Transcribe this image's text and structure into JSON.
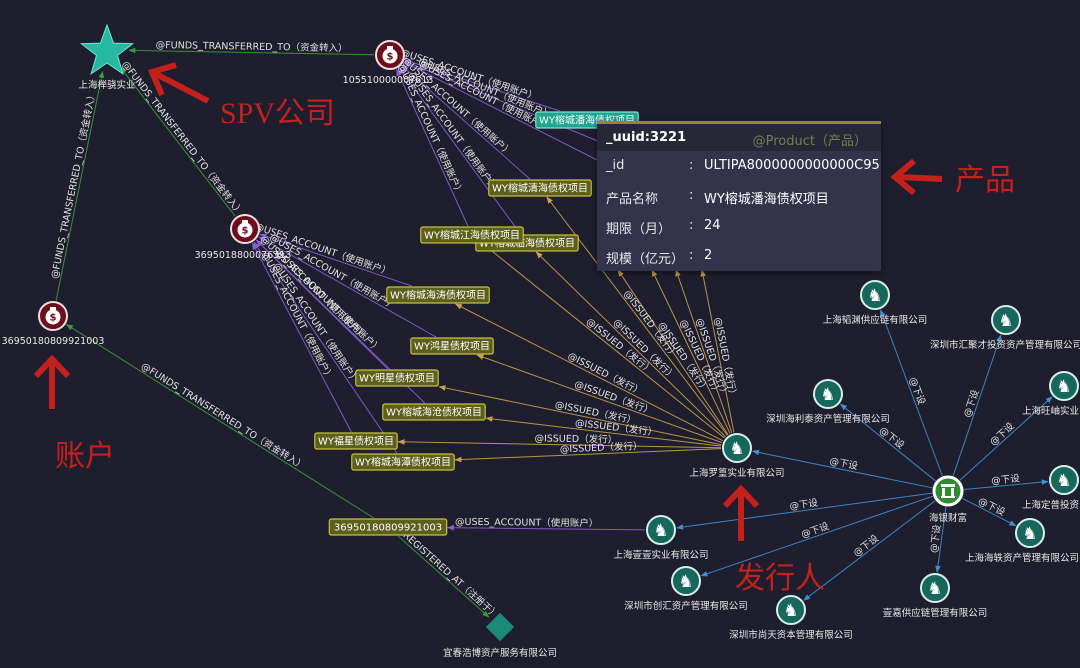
{
  "colors": {
    "background": "#1f1e2e",
    "funds": "#3c9c3c",
    "uses": "#8a5ed4",
    "issued": "#c9a24e",
    "sub": "#3a90d2",
    "registered": "#3c9c3c",
    "company": "#17675d",
    "account": "#6e0d1c",
    "hub": "#2e8b2e",
    "spv": "#26b8a0",
    "registry": "#1b8a78",
    "product_fill": "#5d5f1c",
    "product_border": "#c6c23c",
    "product_selected": "#1ea68f",
    "annotation": "#c4201c"
  },
  "nodes": [
    {
      "id": "spv",
      "icon": "star-icon",
      "label": "上海榉骁实业"
    },
    {
      "id": "acct_a",
      "icon": "money-bag-icon",
      "label": "105510000007613"
    },
    {
      "id": "acct_b",
      "icon": "money-bag-icon",
      "label": "3695018800076313"
    },
    {
      "id": "acct_c",
      "icon": "money-bag-icon",
      "label": "36950180809921003"
    },
    {
      "id": "box_acct",
      "icon": "account-box",
      "label": "36950180809921003"
    },
    {
      "id": "issuer",
      "icon": "knight-icon",
      "label": "上海罗篁实业有限公司"
    },
    {
      "id": "haiyin",
      "icon": "bank-icon",
      "label": "海银财富"
    },
    {
      "id": "c1",
      "icon": "knight-icon",
      "label": "深圳海利泰资产管理有限公司"
    },
    {
      "id": "c2",
      "icon": "knight-icon",
      "label": "上海韬渊供应链有限公司"
    },
    {
      "id": "c3",
      "icon": "knight-icon",
      "label": "深圳市汇聚才投资资产管理有限公司"
    },
    {
      "id": "c4",
      "icon": "knight-icon",
      "label": "上海旺岫实业"
    },
    {
      "id": "c5",
      "icon": "knight-icon",
      "label": "上海定普投资"
    },
    {
      "id": "c6",
      "icon": "knight-icon",
      "label": "上海海轶资产管理有限公司"
    },
    {
      "id": "c7",
      "icon": "knight-icon",
      "label": "壹嘉供应链管理有限公司"
    },
    {
      "id": "c8",
      "icon": "knight-icon",
      "label": "深圳市尚天资本管理有限公司"
    },
    {
      "id": "c9",
      "icon": "knight-icon",
      "label": "深圳市创汇资产管理有限公司"
    },
    {
      "id": "c10",
      "icon": "knight-icon",
      "label": "上海壹壹实业有限公司"
    },
    {
      "id": "reg",
      "icon": "diamond-icon",
      "label": "宜春浩博资产服务有限公司"
    }
  ],
  "products": [
    {
      "id": "p1",
      "label": "WY榕城潘海债权项目",
      "selected": true
    },
    {
      "id": "p2",
      "label": "WY榕城清海债权项目",
      "selected": false
    },
    {
      "id": "p4",
      "label": "WY榕城临海债权项目",
      "selected": false
    },
    {
      "id": "p3",
      "label": "WY榕城江海债权项目",
      "selected": false
    },
    {
      "id": "p5",
      "label": "WY榕城海涛债权项目",
      "selected": false
    },
    {
      "id": "p6",
      "label": "WY鸿星债权项目",
      "selected": false
    },
    {
      "id": "p7",
      "label": "WY明星债权项目",
      "selected": false
    },
    {
      "id": "p8",
      "label": "WY榕城海沧债权项目",
      "selected": false
    },
    {
      "id": "p9",
      "label": "WY福星债权项目",
      "selected": false
    },
    {
      "id": "p10",
      "label": "WY榕城海潭债权项目",
      "selected": false
    }
  ],
  "edges": [
    {
      "from": "acct_a",
      "to": "spv",
      "type": "funds",
      "label": "@FUNDS_TRANSFERRED_TO（资金转入）"
    },
    {
      "from": "acct_c",
      "to": "spv",
      "type": "funds",
      "label": "@FUNDS_TRANSFERRED_TO（资金转入）"
    },
    {
      "from": "acct_b",
      "to": "spv",
      "type": "funds",
      "label": "@FUNDS_TRANSFERRED_TO（资金转入）"
    },
    {
      "from": "box_acct",
      "to": "acct_c",
      "type": "funds",
      "label": "@FUNDS_TRANSFERRED_TO（资金转入）"
    },
    {
      "from": "c10",
      "to": "box_acct",
      "type": "uses",
      "label": "@USES_ACCOUNT（使用账户）"
    },
    {
      "from": "box_acct",
      "to": "reg",
      "type": "registered",
      "label": "@REGISTERED_AT（注册于）"
    },
    {
      "from": "p1",
      "to": "acct_a",
      "type": "uses",
      "label": "@USES_ACCOUNT（使用账户）"
    },
    {
      "from": "a1",
      "to": "acct_a",
      "type": "uses",
      "label": "@USES_ACCOUNT（使用账户）"
    },
    {
      "from": "a2",
      "to": "acct_a",
      "type": "uses",
      "label": "@USES_ACCOUNT（使用账户）"
    },
    {
      "from": "p2",
      "to": "acct_a",
      "type": "uses",
      "label": "@USES_ACCOUNT（使用账户）"
    },
    {
      "from": "p4",
      "to": "acct_a",
      "type": "uses",
      "label": "@USES_ACCOUNT（使用账户）"
    },
    {
      "from": "p3",
      "to": "acct_a",
      "type": "uses",
      "label": "@USES_ACCOUNT（使用账户）"
    },
    {
      "from": "p5",
      "to": "acct_b",
      "type": "uses",
      "label": "@USES_ACCOUNT（使用账户）"
    },
    {
      "from": "p6",
      "to": "acct_b",
      "type": "uses",
      "label": "@USES_ACCOUNT（使用账户）"
    },
    {
      "from": "p7",
      "to": "acct_b",
      "type": "uses",
      "label": "@USES_ACCOUNT（使用账户）"
    },
    {
      "from": "p8",
      "to": "acct_b",
      "type": "uses",
      "label": "@USES_ACCOUNT（使用账户）"
    },
    {
      "from": "p9",
      "to": "acct_b",
      "type": "uses",
      "label": "@USES_ACCOUNT（使用账户）"
    },
    {
      "from": "p10",
      "to": "acct_b",
      "type": "uses",
      "label": "@USES_ACCOUNT（使用账户）"
    },
    {
      "from": "issuer",
      "to": "p2",
      "type": "issued",
      "label": "@ISSUED（发行）"
    },
    {
      "from": "issuer",
      "to": "p3",
      "type": "issued",
      "label": "@ISSUED（发行）"
    },
    {
      "from": "issuer",
      "to": "p4",
      "type": "issued",
      "label": "@ISSUED（发行）"
    },
    {
      "from": "issuer",
      "to": "p5",
      "type": "issued",
      "label": "@ISSUED（发行）"
    },
    {
      "from": "issuer",
      "to": "p6",
      "type": "issued",
      "label": "@ISSUED（发行）"
    },
    {
      "from": "issuer",
      "to": "p7",
      "type": "issued",
      "label": "@ISSUED（发行）"
    },
    {
      "from": "issuer",
      "to": "p8",
      "type": "issued",
      "label": "@ISSUED（发行）"
    },
    {
      "from": "issuer",
      "to": "p9",
      "type": "issued",
      "label": "@ISSUED（发行）"
    },
    {
      "from": "issuer",
      "to": "p10",
      "type": "issued",
      "label": "@ISSUED（发行）"
    },
    {
      "from": "issuer",
      "to": "i1",
      "type": "issued",
      "label": "@ISSUED（发行）"
    },
    {
      "from": "issuer",
      "to": "i2",
      "type": "issued",
      "label": "@ISSUED（发行）"
    },
    {
      "from": "issuer",
      "to": "i3",
      "type": "issued",
      "label": "@ISSUED（发行）"
    },
    {
      "from": "issuer",
      "to": "i4",
      "type": "issued",
      "label": "@ISSUED（发行）"
    },
    {
      "from": "haiyin",
      "to": "issuer",
      "type": "sub",
      "label": "@下设"
    },
    {
      "from": "haiyin",
      "to": "c1",
      "type": "sub",
      "label": "@下设"
    },
    {
      "from": "haiyin",
      "to": "c2",
      "type": "sub",
      "label": "@下设"
    },
    {
      "from": "haiyin",
      "to": "c3",
      "type": "sub",
      "label": "@下设"
    },
    {
      "from": "haiyin",
      "to": "c4",
      "type": "sub",
      "label": "@下设"
    },
    {
      "from": "haiyin",
      "to": "c5",
      "type": "sub",
      "label": "@下设"
    },
    {
      "from": "haiyin",
      "to": "c6",
      "type": "sub",
      "label": "@下设"
    },
    {
      "from": "haiyin",
      "to": "c7",
      "type": "sub",
      "label": "@下设"
    },
    {
      "from": "haiyin",
      "to": "c8",
      "type": "sub",
      "label": "@下设"
    },
    {
      "from": "haiyin",
      "to": "c9",
      "type": "sub",
      "label": "@下设"
    },
    {
      "from": "haiyin",
      "to": "c10",
      "type": "sub",
      "label": "@下设"
    }
  ],
  "tooltip": {
    "uuid": "_uuid:3221",
    "schema": "@Product（产品）",
    "sep": ":",
    "rows": [
      {
        "key": "_id",
        "value": "ULTIPA8000000000000C95"
      },
      {
        "key": "产品名称",
        "value": "WY榕城潘海债权项目"
      },
      {
        "key": "期限（月）",
        "value": "24"
      },
      {
        "key": "规模（亿元）",
        "value": "2"
      }
    ]
  },
  "annotations": {
    "spv": "SPV公司",
    "product": "产品",
    "account": "账户",
    "issuer": "发行人"
  }
}
